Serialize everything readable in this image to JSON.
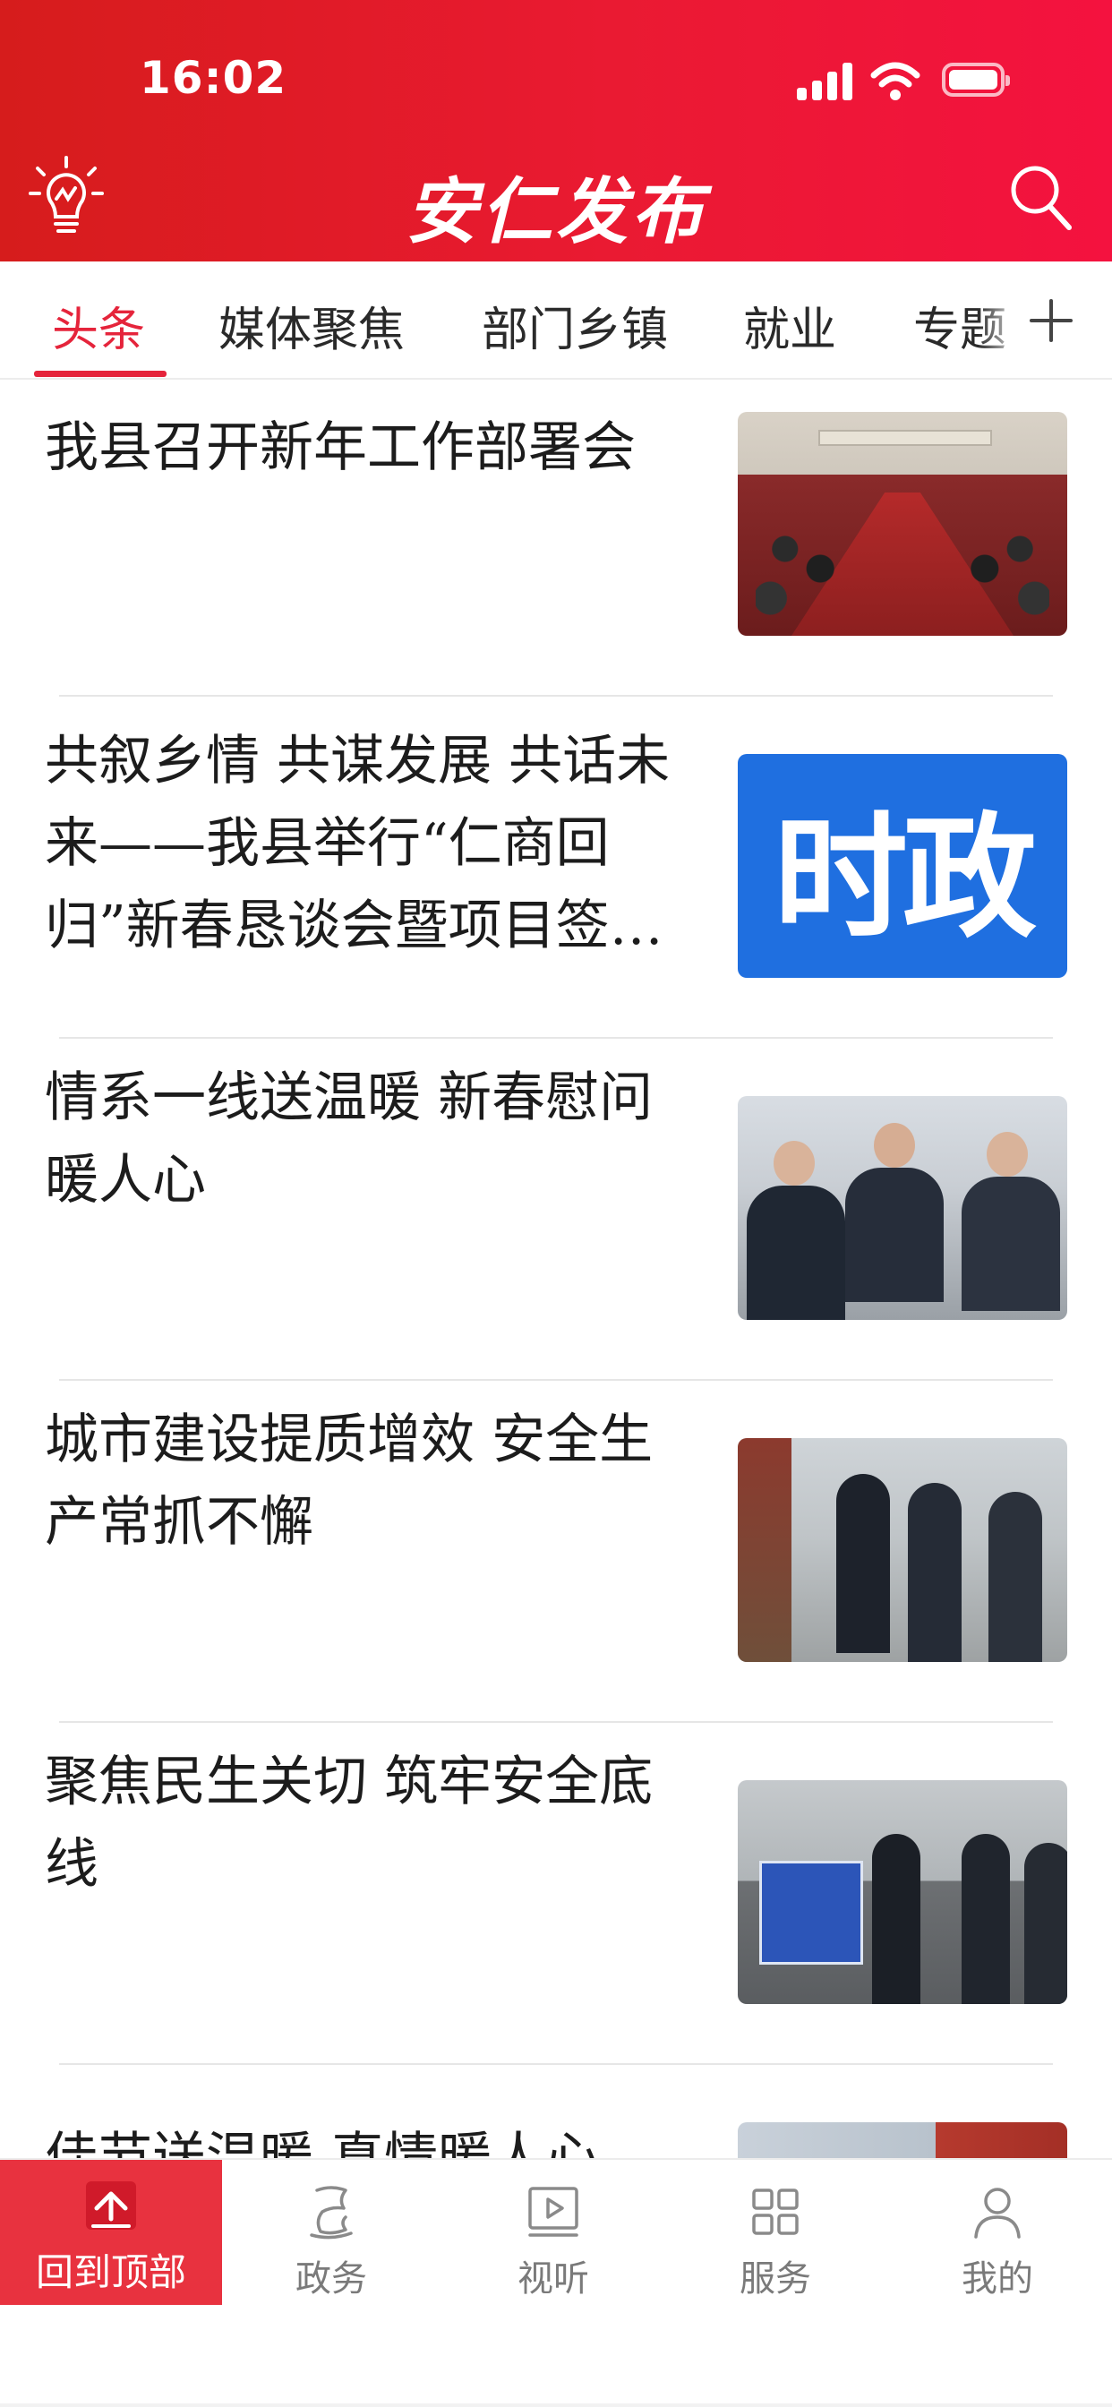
{
  "status_bar": {
    "time": "16:02",
    "signal_icon": "cellular-signal-icon",
    "wifi_icon": "wifi-icon",
    "battery_icon": "battery-icon"
  },
  "header": {
    "title": "安仁发布",
    "left_icon": "lightbulb-icon",
    "right_icon": "search-icon",
    "background_colors": [
      "#d61c1c",
      "#f4123f"
    ]
  },
  "tabs": {
    "items": [
      {
        "label": "头条",
        "active": true
      },
      {
        "label": "媒体聚焦",
        "active": false
      },
      {
        "label": "部门乡镇",
        "active": false
      },
      {
        "label": "就业",
        "active": false
      },
      {
        "label": "专题",
        "active": false
      }
    ],
    "add_icon": "plus-icon",
    "active_color": "#e5243b"
  },
  "news": [
    {
      "title": "我县召开新年工作部署会",
      "thumb": "meeting"
    },
    {
      "title": "共叙乡情 共谋发展 共话未来——我县举行“仁商回归”新春恳谈会暨项目签…",
      "thumb": "politics",
      "thumb_text": "时政"
    },
    {
      "title": "情系一线送温暖  新春慰问暖人心",
      "thumb": "police"
    },
    {
      "title": "城市建设提质增效 安全生产常抓不懈",
      "thumb": "street"
    },
    {
      "title": "聚焦民生关切 筑牢安全底线",
      "thumb": "road"
    },
    {
      "title": "佳节送温暖 真情暖人心",
      "thumb": "partial"
    }
  ],
  "back_to_top": {
    "label": "回到顶部",
    "icon": "arrow-up-icon",
    "color": "#e8323f"
  },
  "bottom_nav": [
    {
      "label": "政务",
      "icon": "government-icon"
    },
    {
      "label": "视听",
      "icon": "play-video-icon"
    },
    {
      "label": "服务",
      "icon": "grid-services-icon"
    },
    {
      "label": "我的",
      "icon": "user-icon"
    }
  ]
}
